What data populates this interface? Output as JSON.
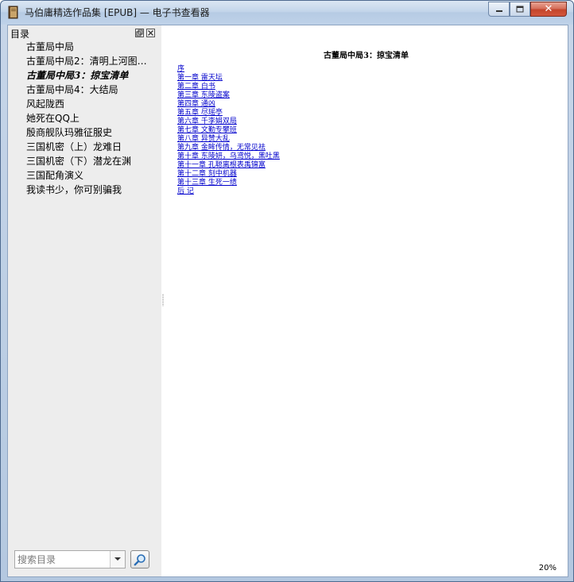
{
  "window": {
    "title": "马伯庸精选作品集 [EPUB] — 电子书查看器",
    "icon": "book-icon"
  },
  "sidebar": {
    "title": "目录",
    "items": [
      {
        "label": "古董局中局"
      },
      {
        "label": "古董局中局2：清明上河图…"
      },
      {
        "label": "古董局中局3：掠宝清单"
      },
      {
        "label": "古董局中局4：大结局"
      },
      {
        "label": "风起陇西"
      },
      {
        "label": "她死在QQ上"
      },
      {
        "label": "殷商舰队玛雅征服史"
      },
      {
        "label": "三国机密（上）龙难日"
      },
      {
        "label": "三国机密（下）潜龙在渊"
      },
      {
        "label": "三国配角演义"
      },
      {
        "label": "我读书少，你可别骗我"
      }
    ],
    "active_index": 2,
    "search": {
      "placeholder": "搜索目录",
      "value": ""
    }
  },
  "content": {
    "chapter_title": "古董局中局3：掠宝清单",
    "links": [
      {
        "label": "序"
      },
      {
        "label": "第一章 雷天坛"
      },
      {
        "label": "第二章 白书"
      },
      {
        "label": "第三章 东陵盗案"
      },
      {
        "label": "第四章 通凶"
      },
      {
        "label": "第五章 尽瑶亭"
      },
      {
        "label": "第六章 千李娟双局"
      },
      {
        "label": "第七章 文勤专攀班"
      },
      {
        "label": "第八章 异赞大乱"
      },
      {
        "label": "第九章 金眸传情，无常见祛"
      },
      {
        "label": "第十章 东陵妍，乌鸢悦，黑吐黑"
      },
      {
        "label": "第十一章 孔聪离根表禹锦富"
      },
      {
        "label": "第十二章 刻中机器"
      },
      {
        "label": "第十三章 生死一绩"
      },
      {
        "label": "后 记"
      }
    ],
    "zoom": "20%"
  },
  "colors": {
    "link": "#0000cc",
    "sidebar_bg": "#ededed",
    "close_button": "#c4452c"
  }
}
